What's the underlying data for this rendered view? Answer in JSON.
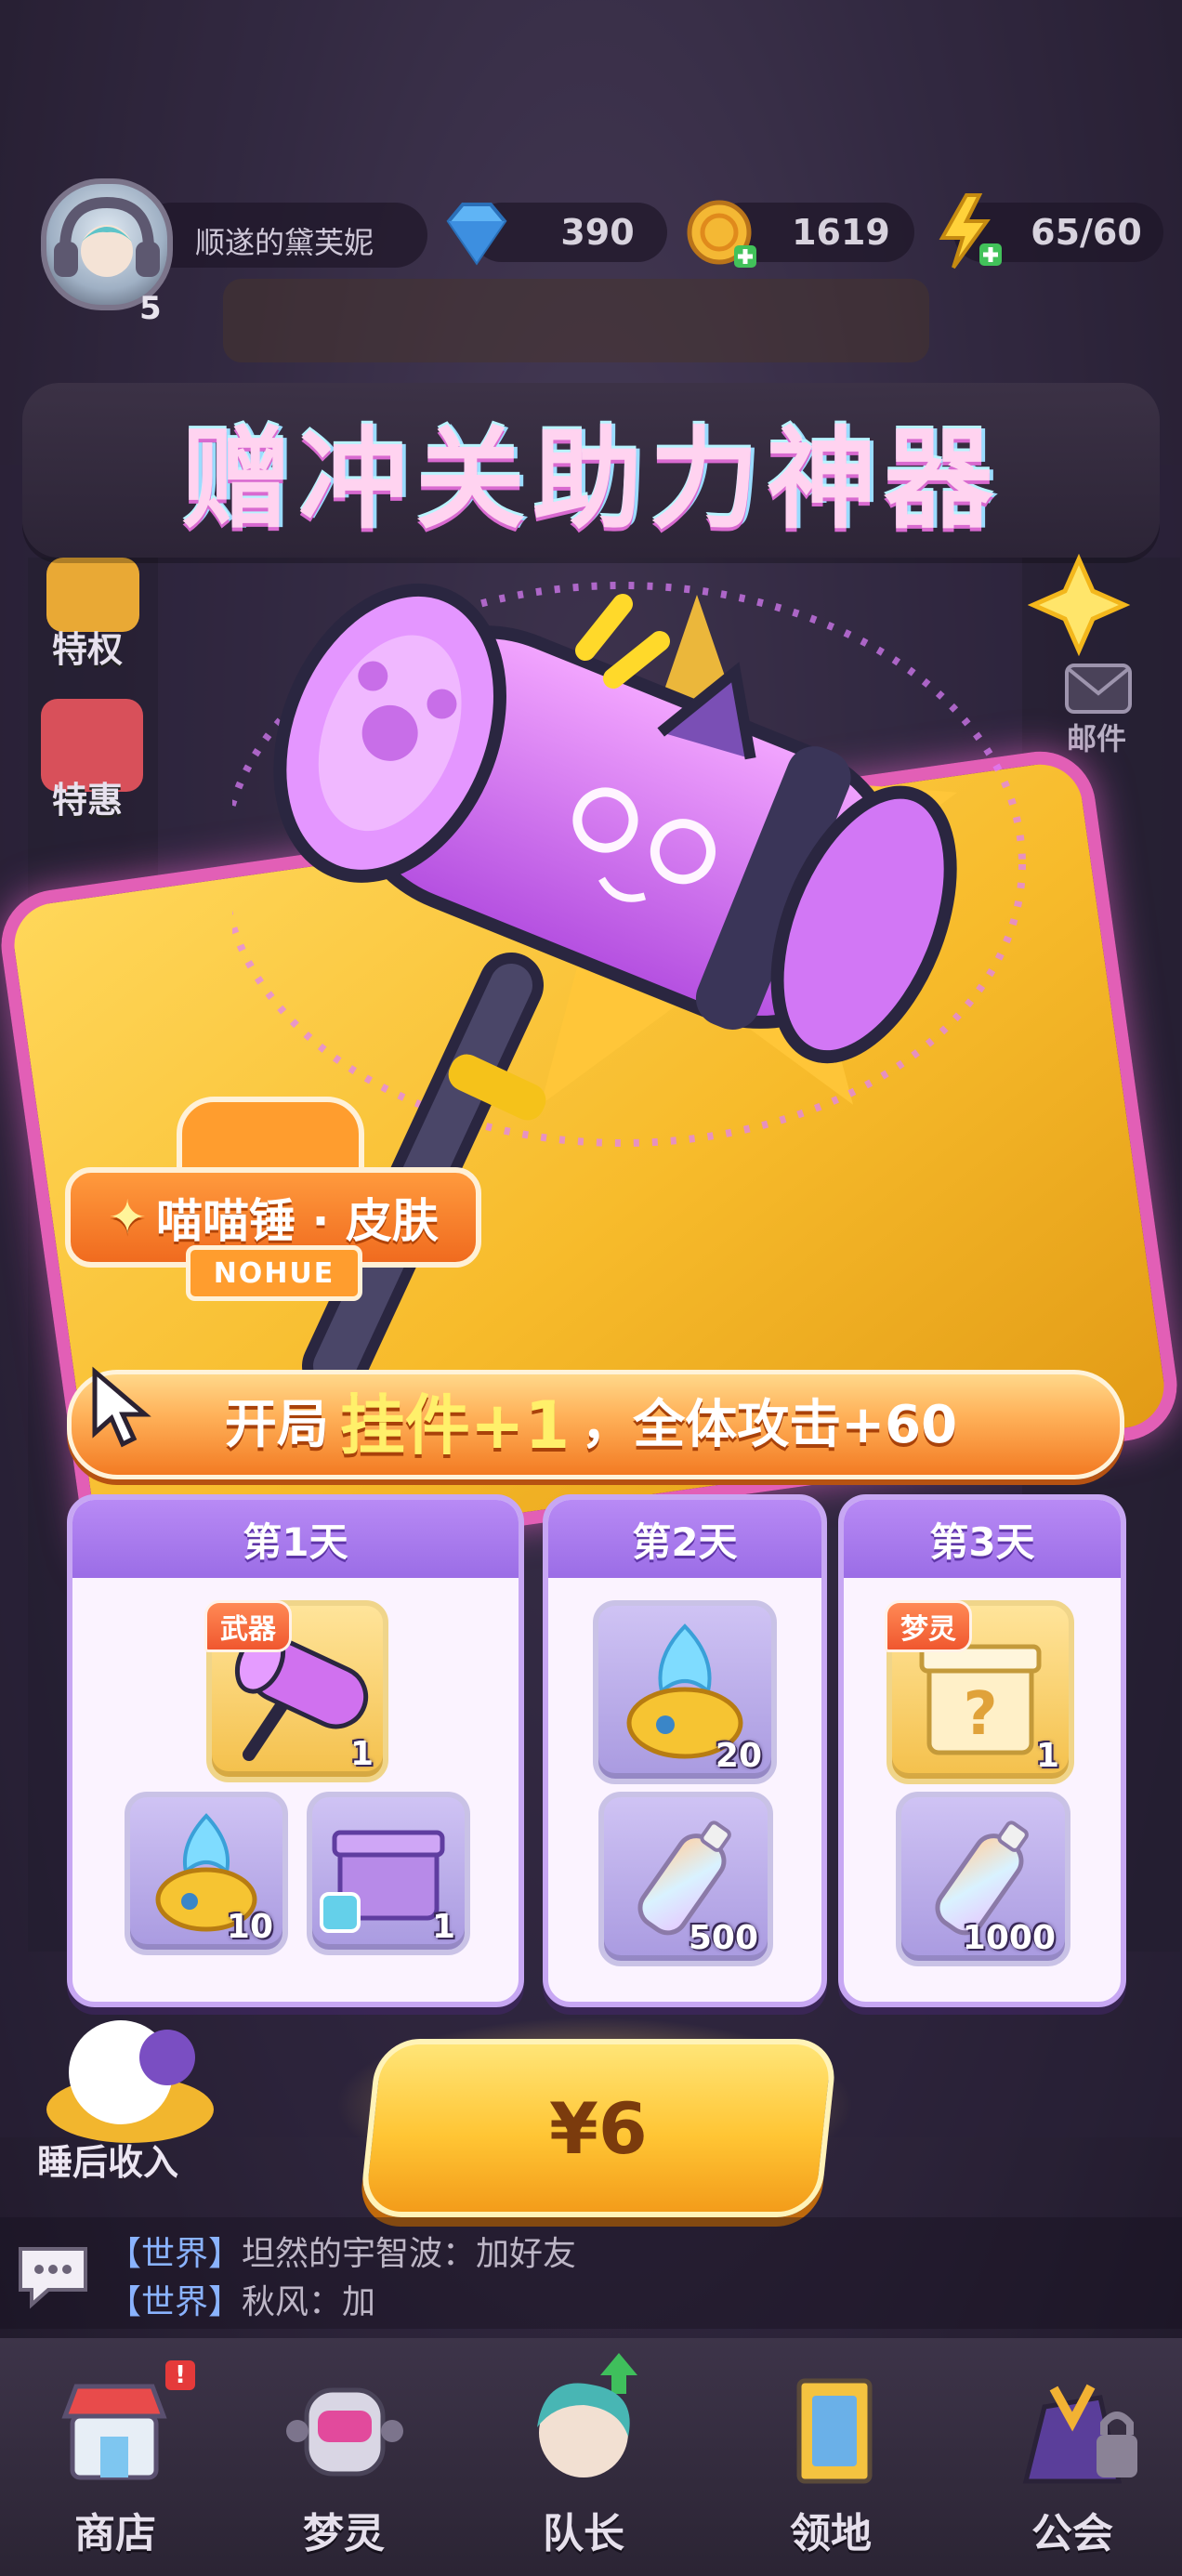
{
  "header": {
    "username": "顺遂的黛芙妮",
    "level": "5",
    "diamonds": "390",
    "coins": "1619",
    "energy": "65/60"
  },
  "title": "赠冲关助力神器",
  "side_left": [
    {
      "label": "特权"
    },
    {
      "label": "特惠"
    }
  ],
  "side_right": [
    {
      "label": "邮件"
    }
  ],
  "skin": {
    "name": "喵喵锤 · 皮肤",
    "badge_text": "NOHUE"
  },
  "buff": {
    "prefix": "开局",
    "highlight": "挂件+1",
    "suffix": "，全体攻击+60"
  },
  "days": [
    {
      "title": "第1天",
      "items": [
        {
          "name": "meow-hammer",
          "tag": "武器",
          "qty": "1"
        },
        {
          "name": "blue-flame-pot",
          "qty": "10"
        },
        {
          "name": "mystery-box",
          "qty": "1"
        }
      ]
    },
    {
      "title": "第2天",
      "items": [
        {
          "name": "blue-flame-pot",
          "qty": "20"
        },
        {
          "name": "rainbow-bottle",
          "qty": "500"
        }
      ]
    },
    {
      "title": "第3天",
      "items": [
        {
          "name": "question-gift-box",
          "tag": "梦灵",
          "qty": "1"
        },
        {
          "name": "rainbow-bottle",
          "qty": "1000"
        }
      ]
    }
  ],
  "price": "¥6",
  "sleep_income": "睡后收入",
  "chat": [
    {
      "channel": "【世界】",
      "text": "坦然的宇智波：加好友"
    },
    {
      "channel": "【世界】",
      "text": "秋风：加"
    }
  ],
  "nav": [
    {
      "label": "商店",
      "badge": "!"
    },
    {
      "label": "梦灵"
    },
    {
      "label": "队长"
    },
    {
      "label": "领地"
    },
    {
      "label": "公会"
    }
  ],
  "colors": {
    "accent": "#b88af5",
    "buff_orange": "#f37b23",
    "price_gold": "#ffc534"
  }
}
